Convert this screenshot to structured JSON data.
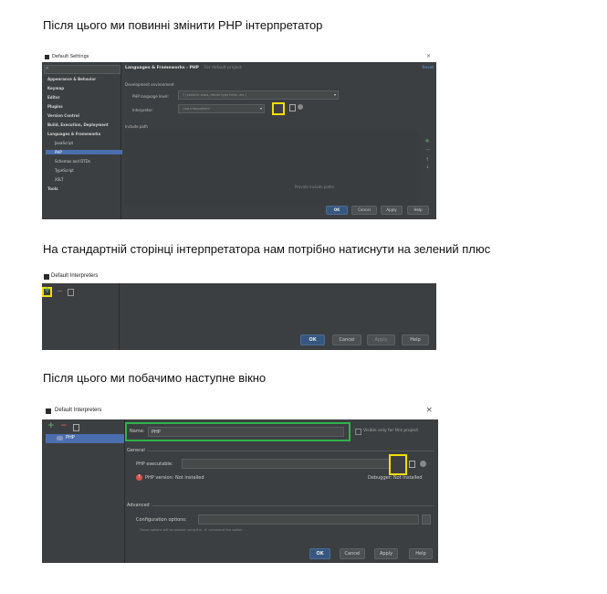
{
  "paragraphs": {
    "p1": "Після цього ми повинні змінити PHP інтерпретатор",
    "p2": "На стандартній сторінці інтерпретатора нам потрібно натиснути на зелений плюс",
    "p3": "Після цього ми побачимо наступне вікно"
  },
  "shot1": {
    "window_title": "Default Settings",
    "breadcrumb": "Languages & Frameworks › PHP",
    "breadcrumb_note": "For default project",
    "reset": "Reset",
    "sidebar": [
      {
        "label": "Appearance & Behavior",
        "bold": true
      },
      {
        "label": "Keymap",
        "bold": true
      },
      {
        "label": "Editor",
        "bold": true
      },
      {
        "label": "Plugins",
        "bold": true
      },
      {
        "label": "Version Control",
        "bold": true
      },
      {
        "label": "Build, Execution, Deployment",
        "bold": true
      },
      {
        "label": "Languages & Frameworks",
        "bold": true
      },
      {
        "label": "JavaScript",
        "bold": false
      },
      {
        "label": "PHP",
        "bold": false,
        "selected": true
      },
      {
        "label": "Schemas and DTDs",
        "bold": false
      },
      {
        "label": "TypeScript",
        "bold": false
      },
      {
        "label": "XSLT",
        "bold": false
      },
      {
        "label": "Tools",
        "bold": true
      }
    ],
    "section": "Development environment",
    "lang_level_label": "PHP language level:",
    "lang_level_value": "7 (const in class, return type hints, etc.)",
    "interpreter_label": "Interpreter:",
    "interpreter_value": "<no interpreter>",
    "include_path": "Include path",
    "empty_hint": "Provide include paths",
    "buttons": {
      "ok": "OK",
      "cancel": "Cancel",
      "apply": "Apply",
      "help": "Help"
    }
  },
  "shot2": {
    "window_title": "Default Interpreters",
    "buttons": {
      "ok": "OK",
      "cancel": "Cancel",
      "apply": "Apply",
      "help": "Help"
    }
  },
  "shot3": {
    "window_title": "Default Interpreters",
    "close": "×",
    "list_item": "PHP",
    "name_label": "Name:",
    "name_value": "PHP",
    "visible_only": "Visible only for this project",
    "general": "General",
    "php_executable_label": "PHP executable:",
    "php_version": "PHP version: Not installed",
    "debugger": "Debugger: Not installed",
    "advanced": "Advanced",
    "config_options": "Configuration options:",
    "config_hint": "Those options will be passed using the '-d' command line option",
    "buttons": {
      "ok": "OK",
      "cancel": "Cancel",
      "apply": "Apply",
      "help": "Help"
    }
  },
  "colors": {
    "panel": "#3c3f41",
    "selection": "#4b6eaf",
    "highlight_yellow": "#f0e000",
    "highlight_green": "#2fb24a",
    "plus_green": "#59a869",
    "minus_red": "#c75450"
  }
}
